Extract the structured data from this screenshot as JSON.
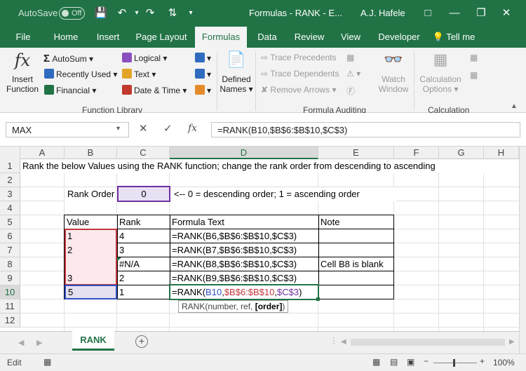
{
  "window": {
    "autosave_label": "AutoSave",
    "autosave_state": "Off",
    "title": "Formulas - RANK  -  E...",
    "user": "A.J. Hafele"
  },
  "tabs": [
    "File",
    "Home",
    "Insert",
    "Page Layout",
    "Formulas",
    "Data",
    "Review",
    "View",
    "Developer"
  ],
  "tell_me": "Tell me",
  "ribbon": {
    "insert_function": [
      "Insert",
      "Function"
    ],
    "autosum": "AutoSum",
    "recently_used": "Recently Used",
    "financial": "Financial",
    "logical": "Logical",
    "text": "Text",
    "date_time": "Date & Time",
    "defined_names": [
      "Defined",
      "Names"
    ],
    "trace_precedents": "Trace Precedents",
    "trace_dependents": "Trace Dependents",
    "remove_arrows": "Remove Arrows",
    "watch_window": [
      "Watch",
      "Window"
    ],
    "calc_options": [
      "Calculation",
      "Options"
    ],
    "group_function_library": "Function Library",
    "group_formula_auditing": "Formula Auditing",
    "group_calculation": "Calculation"
  },
  "formula_bar": {
    "name_box": "MAX",
    "formula": "=RANK(B10,$B$6:$B$10,$C$3)"
  },
  "columns": [
    "A",
    "B",
    "C",
    "D",
    "E",
    "F",
    "G",
    "H"
  ],
  "rows": [
    "1",
    "2",
    "3",
    "4",
    "5",
    "6",
    "7",
    "8",
    "9",
    "10",
    "11",
    "12"
  ],
  "sheet": {
    "a1": "Rank the below Values using the RANK function; change the rank order from descending to ascending",
    "rank_order_label": "Rank Order",
    "rank_order_value": "0",
    "rank_order_note": "<-- 0 = descending order; 1 = ascending order",
    "headers": [
      "Value",
      "Rank",
      "Formula Text",
      "Note"
    ],
    "table": [
      {
        "value": "1",
        "rank": "4",
        "formula": "=RANK(B6,$B$6:$B$10,$C$3)",
        "note": ""
      },
      {
        "value": "2",
        "rank": "3",
        "formula": "=RANK(B7,$B$6:$B$10,$C$3)",
        "note": ""
      },
      {
        "value": "",
        "rank": "#N/A",
        "formula": "=RANK(B8,$B$6:$B$10,$C$3)",
        "note": "Cell B8 is blank"
      },
      {
        "value": "3",
        "rank": "2",
        "formula": "=RANK(B9,$B$6:$B$10,$C$3)",
        "note": ""
      },
      {
        "value": "5",
        "rank": "1",
        "formula": "",
        "note": ""
      }
    ],
    "edit_formula": {
      "f1": "=RANK(",
      "f2": "B10",
      "f3": ",",
      "f4": "$B$6:$B$10",
      "f5": ",",
      "f6": "$C$3",
      "f7": ")"
    },
    "tooltip": {
      "t1": "RANK(number, ref, ",
      "t2": "[order]",
      "t3": ")"
    }
  },
  "sheet_tab": "RANK",
  "status": {
    "mode": "Edit",
    "zoom": "100%"
  },
  "colors": {
    "accent": "#217346",
    "ref_blue": "#2f52c4",
    "ref_red": "#c0383e",
    "ref_purple": "#7030a0"
  }
}
